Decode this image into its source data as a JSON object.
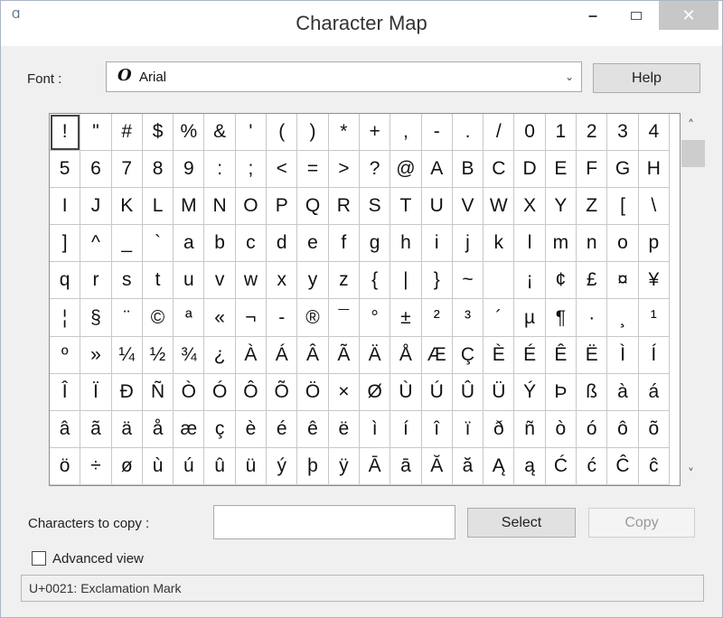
{
  "window": {
    "title": "Character Map",
    "app_icon": "character-map-icon",
    "controls": {
      "minimize": "–",
      "maximize": "maximize-icon",
      "close": "✕"
    }
  },
  "font": {
    "label": "Font :",
    "selected": "Arial",
    "glyph": "O",
    "chevron": "⌄"
  },
  "help_label": "Help",
  "grid": {
    "selected_index": 0,
    "characters": [
      "!",
      "\"",
      "#",
      "$",
      "%",
      "&",
      "'",
      "(",
      ")",
      "*",
      "+",
      ",",
      "-",
      ".",
      "/",
      "0",
      "1",
      "2",
      "3",
      "4",
      "5",
      "6",
      "7",
      "8",
      "9",
      ":",
      ";",
      "<",
      "=",
      ">",
      "?",
      "@",
      "A",
      "B",
      "C",
      "D",
      "E",
      "F",
      "G",
      "H",
      "I",
      "J",
      "K",
      "L",
      "M",
      "N",
      "O",
      "P",
      "Q",
      "R",
      "S",
      "T",
      "U",
      "V",
      "W",
      "X",
      "Y",
      "Z",
      "[",
      "\\",
      "]",
      "^",
      "_",
      "`",
      "a",
      "b",
      "c",
      "d",
      "e",
      "f",
      "g",
      "h",
      "i",
      "j",
      "k",
      "l",
      "m",
      "n",
      "o",
      "p",
      "q",
      "r",
      "s",
      "t",
      "u",
      "v",
      "w",
      "x",
      "y",
      "z",
      "{",
      "|",
      "}",
      "~",
      " ",
      "¡",
      "¢",
      "£",
      "¤",
      "¥",
      "¦",
      "§",
      "¨",
      "©",
      "ª",
      "«",
      "¬",
      "-",
      "®",
      "¯",
      "°",
      "±",
      "²",
      "³",
      "´",
      "µ",
      "¶",
      "·",
      "¸",
      "¹",
      "º",
      "»",
      "¼",
      "½",
      "¾",
      "¿",
      "À",
      "Á",
      "Â",
      "Ã",
      "Ä",
      "Å",
      "Æ",
      "Ç",
      "È",
      "É",
      "Ê",
      "Ë",
      "Ì",
      "Í",
      "Î",
      "Ï",
      "Ð",
      "Ñ",
      "Ò",
      "Ó",
      "Ô",
      "Õ",
      "Ö",
      "×",
      "Ø",
      "Ù",
      "Ú",
      "Û",
      "Ü",
      "Ý",
      "Þ",
      "ß",
      "à",
      "á",
      "â",
      "ã",
      "ä",
      "å",
      "æ",
      "ç",
      "è",
      "é",
      "ê",
      "ë",
      "ì",
      "í",
      "î",
      "ï",
      "ð",
      "ñ",
      "ò",
      "ó",
      "ô",
      "õ",
      "ö",
      "÷",
      "ø",
      "ù",
      "ú",
      "û",
      "ü",
      "ý",
      "þ",
      "ÿ",
      "Ā",
      "ā",
      "Ă",
      "ă",
      "Ą",
      "ą",
      "Ć",
      "ć",
      "Ĉ",
      "ĉ"
    ]
  },
  "scrollbar": {
    "up": "˄",
    "down": "˅"
  },
  "copy": {
    "label": "Characters to copy :",
    "value": "",
    "select_label": "Select",
    "copy_label": "Copy"
  },
  "advanced": {
    "label": "Advanced view",
    "checked": false
  },
  "status": "U+0021: Exclamation Mark"
}
